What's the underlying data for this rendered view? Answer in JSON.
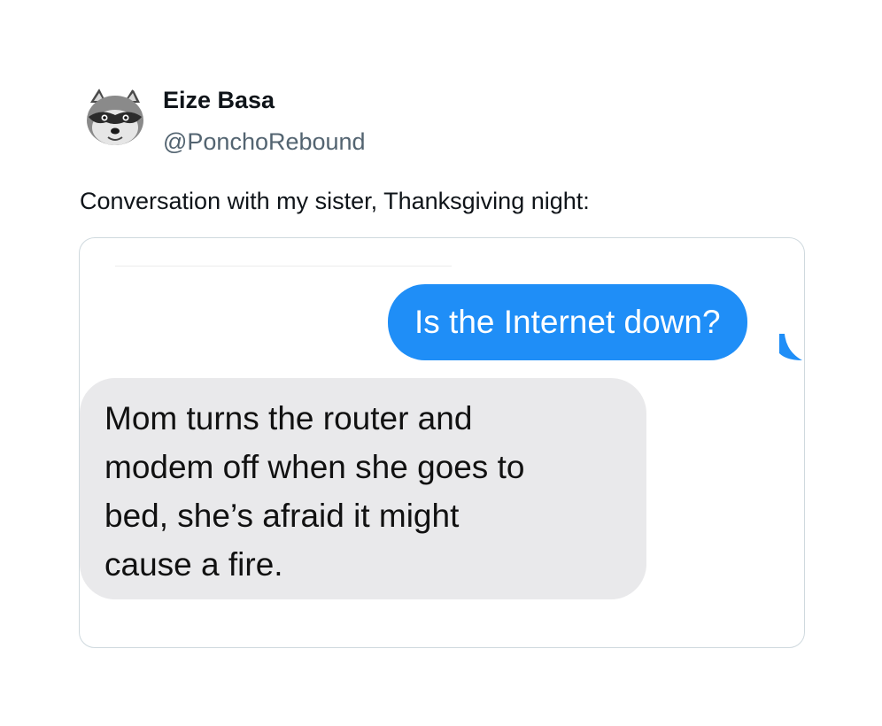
{
  "tweet": {
    "display_name": "Eize Basa",
    "handle": "@PonchoRebound",
    "text": "Conversation with my sister, Thanksgiving night:",
    "avatar_icon": "raccoon-avatar-icon"
  },
  "messages": {
    "outgoing": "Is the Internet down?",
    "incoming_lines": [
      "Mom turns the router and",
      "modem off when she goes to",
      "bed, she’s afraid it might",
      "cause a fire."
    ]
  },
  "colors": {
    "outgoing_bubble": "#1f8ef7",
    "incoming_bubble": "#e9e9eb",
    "handle_text": "#536471",
    "card_border": "#cfd9de"
  }
}
